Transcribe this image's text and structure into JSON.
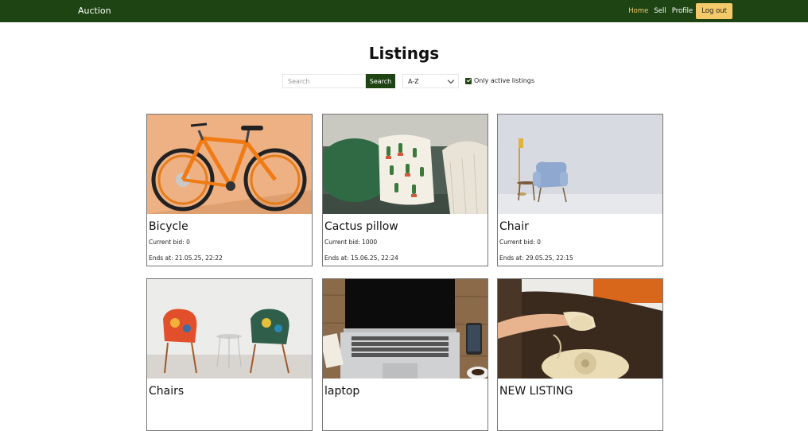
{
  "navbar": {
    "brand": "Auction",
    "links": [
      {
        "label": "Home",
        "active": true
      },
      {
        "label": "Sell",
        "active": false
      },
      {
        "label": "Profile",
        "active": false
      }
    ],
    "logout_label": "Log out"
  },
  "page_title": "Listings",
  "controls": {
    "search_placeholder": "Search",
    "search_button": "Search",
    "sort_value": "A-Z",
    "active_only_label": "Only active listings",
    "active_only_checked": true
  },
  "listings": [
    {
      "title": "Bicycle",
      "bid": "Current bid: 0",
      "ends": "Ends at: 21.05.25, 22:22",
      "image": "bicycle"
    },
    {
      "title": "Cactus pillow",
      "bid": "Current bid: 1000",
      "ends": "Ends at: 15.06.25, 22:24",
      "image": "cactus-pillow"
    },
    {
      "title": "Chair",
      "bid": "Current bid: 0",
      "ends": "Ends at: 29.05.25, 22:15",
      "image": "chair"
    },
    {
      "title": "Chairs",
      "bid": "",
      "ends": "",
      "image": "chairs"
    },
    {
      "title": "laptop",
      "bid": "",
      "ends": "",
      "image": "laptop"
    },
    {
      "title": "NEW LISTING",
      "bid": "",
      "ends": "",
      "image": "telephone"
    }
  ],
  "colors": {
    "nav_bg": "#1e4414",
    "accent": "#f3c969"
  }
}
